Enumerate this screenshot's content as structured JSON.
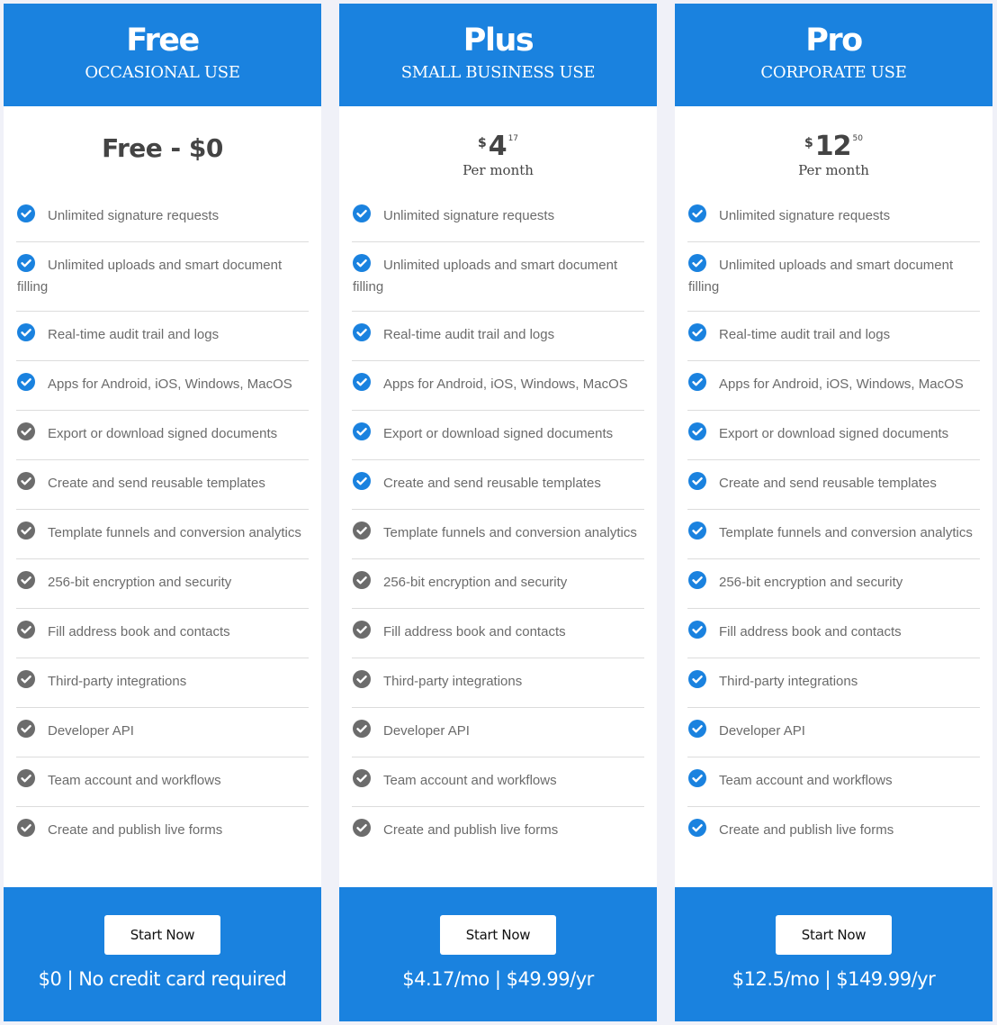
{
  "theme": {
    "accent": "#1a82df",
    "included_check": "#1a82df",
    "excluded_check": "#6c6c6c",
    "background": "#f0f1f8"
  },
  "plans": [
    {
      "name": "Free",
      "subtitle": "OCCASIONAL USE",
      "price_text": "Free - $0",
      "cta_label": "Start Now",
      "footer_note": "$0 | No credit card required",
      "features": [
        {
          "label": "Unlimited signature requests",
          "included": true
        },
        {
          "label": "Unlimited uploads and smart document filling",
          "included": true
        },
        {
          "label": "Real-time audit trail and logs",
          "included": true
        },
        {
          "label": "Apps for Android, iOS, Windows, MacOS",
          "included": true
        },
        {
          "label": "Export or download signed documents",
          "included": false
        },
        {
          "label": "Create and send reusable templates",
          "included": false
        },
        {
          "label": "Template funnels and conversion analytics",
          "included": false
        },
        {
          "label": "256-bit encryption and security",
          "included": false
        },
        {
          "label": "Fill address book and contacts",
          "included": false
        },
        {
          "label": "Third-party integrations",
          "included": false
        },
        {
          "label": "Developer API",
          "included": false
        },
        {
          "label": "Team account and workflows",
          "included": false
        },
        {
          "label": "Create and publish live forms",
          "included": false
        }
      ]
    },
    {
      "name": "Plus",
      "subtitle": "SMALL BUSINESS USE",
      "price": {
        "currency": "$",
        "whole": "4",
        "cents": "17",
        "period": "Per month"
      },
      "cta_label": "Start Now",
      "footer_note": "$4.17/mo | $49.99/yr",
      "features": [
        {
          "label": "Unlimited signature requests",
          "included": true
        },
        {
          "label": "Unlimited uploads and smart document filling",
          "included": true
        },
        {
          "label": "Real-time audit trail and logs",
          "included": true
        },
        {
          "label": "Apps for Android, iOS, Windows, MacOS",
          "included": true
        },
        {
          "label": "Export or download signed documents",
          "included": true
        },
        {
          "label": "Create and send reusable templates",
          "included": true
        },
        {
          "label": "Template funnels and conversion analytics",
          "included": false
        },
        {
          "label": "256-bit encryption and security",
          "included": false
        },
        {
          "label": "Fill address book and contacts",
          "included": false
        },
        {
          "label": "Third-party integrations",
          "included": false
        },
        {
          "label": "Developer API",
          "included": false
        },
        {
          "label": "Team account and workflows",
          "included": false
        },
        {
          "label": "Create and publish live forms",
          "included": false
        }
      ]
    },
    {
      "name": "Pro",
      "subtitle": "CORPORATE USE",
      "price": {
        "currency": "$",
        "whole": "12",
        "cents": "50",
        "period": "Per month"
      },
      "cta_label": "Start Now",
      "footer_note": "$12.5/mo | $149.99/yr",
      "features": [
        {
          "label": "Unlimited signature requests",
          "included": true
        },
        {
          "label": "Unlimited uploads and smart document filling",
          "included": true
        },
        {
          "label": "Real-time audit trail and logs",
          "included": true
        },
        {
          "label": "Apps for Android, iOS, Windows, MacOS",
          "included": true
        },
        {
          "label": "Export or download signed documents",
          "included": true
        },
        {
          "label": "Create and send reusable templates",
          "included": true
        },
        {
          "label": "Template funnels and conversion analytics",
          "included": true
        },
        {
          "label": "256-bit encryption and security",
          "included": true
        },
        {
          "label": "Fill address book and contacts",
          "included": true
        },
        {
          "label": "Third-party integrations",
          "included": true
        },
        {
          "label": "Developer API",
          "included": true
        },
        {
          "label": "Team account and workflows",
          "included": true
        },
        {
          "label": "Create and publish live forms",
          "included": true
        }
      ]
    }
  ]
}
